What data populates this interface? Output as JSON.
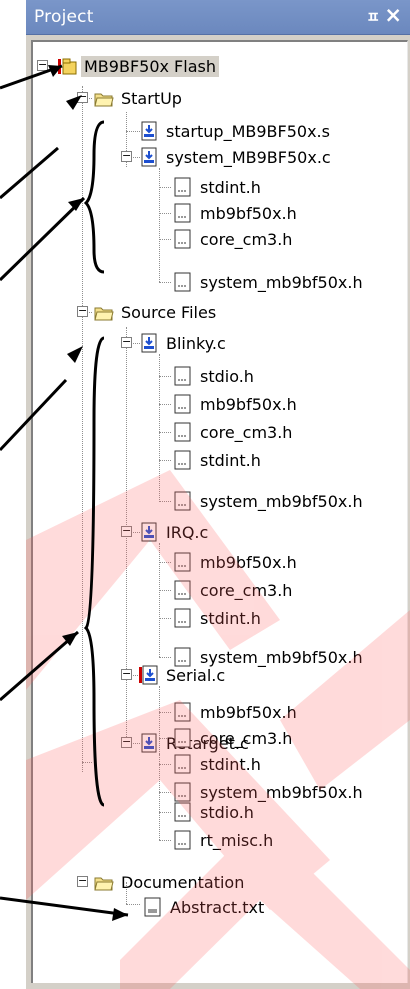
{
  "panel": {
    "title": "Project",
    "pin_glyph": "ㅍ",
    "close_glyph": "×"
  },
  "tree": {
    "root": "MB9BF50x Flash",
    "startup_group": "StartUp",
    "startup_file": "startup_MB9BF50x.s",
    "system_file": "system_MB9BF50x.c",
    "system_deps": [
      "stdint.h",
      "mb9bf50x.h",
      "core_cm3.h",
      "system_mb9bf50x.h"
    ],
    "source_group": "Source Files",
    "blinky": "Blinky.c",
    "blinky_deps": [
      "stdio.h",
      "mb9bf50x.h",
      "core_cm3.h",
      "stdint.h",
      "system_mb9bf50x.h"
    ],
    "irq": "IRQ.c",
    "irq_deps": [
      "mb9bf50x.h",
      "core_cm3.h",
      "stdint.h",
      "system_mb9bf50x.h"
    ],
    "serial": "Serial.c",
    "serial_deps": [
      "mb9bf50x.h",
      "core_cm3.h",
      "stdint.h",
      "system_mb9bf50x.h"
    ],
    "retarget": "Retarget.c",
    "retarget_deps": [
      "stdio.h",
      "rt_misc.h"
    ],
    "doc_group": "Documentation",
    "doc_file": "Abstract.txt"
  },
  "colors": {
    "title_bar": "#6b88be",
    "panel_bg": "#d4d0c8",
    "watermark": "#ff6666",
    "arrow": "#000000"
  },
  "icons": {
    "project": "project-icon",
    "folder": "folder-open-icon",
    "c_file": "c-source-file-icon",
    "header": "header-file-icon",
    "text": "text-file-icon"
  }
}
